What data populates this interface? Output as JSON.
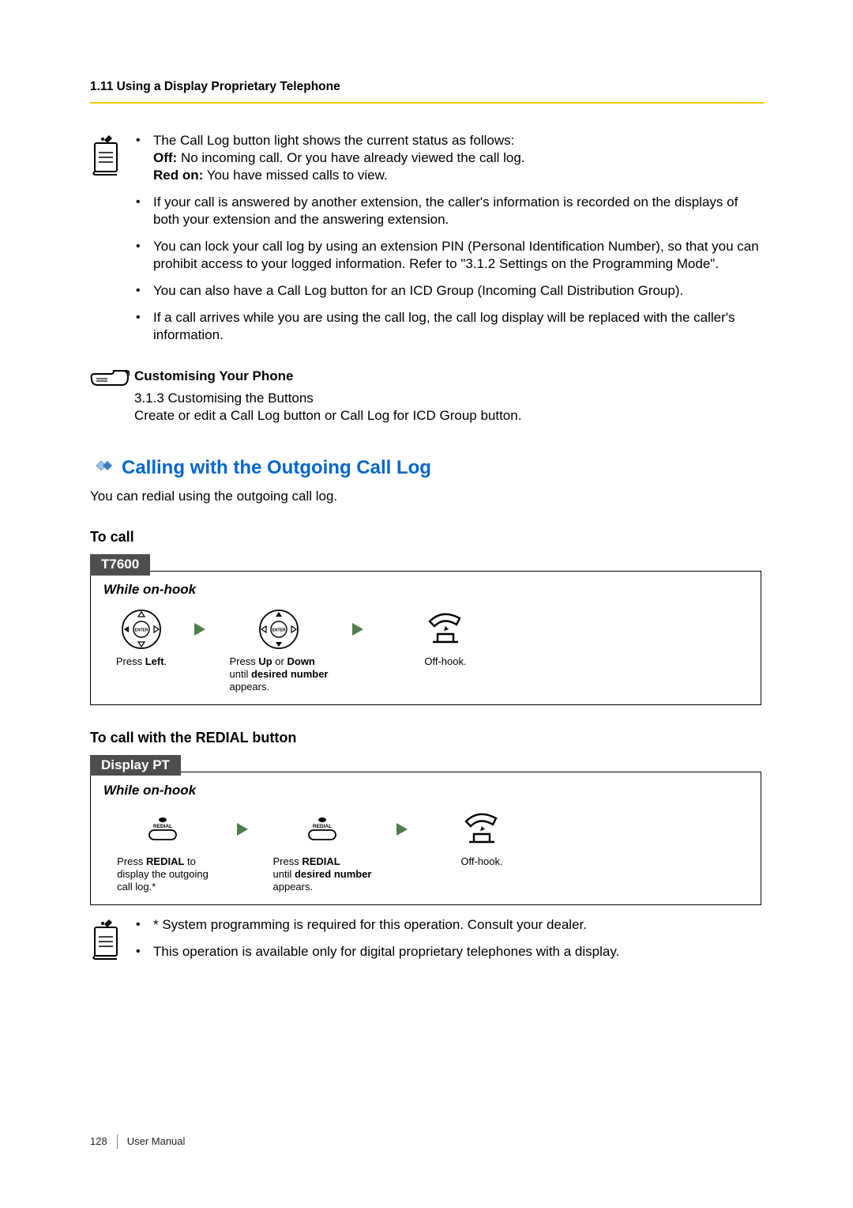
{
  "header": {
    "section": "1.11 Using a Display Proprietary Telephone"
  },
  "notes": {
    "b1_intro": "The Call Log button light shows the current status as follows:",
    "b1_off_label": "Off:",
    "b1_off_text": " No incoming call. Or you have already viewed the call log.",
    "b1_red_label": "Red on:",
    "b1_red_text": " You have missed calls to view.",
    "b2": "If your call is answered by another extension, the caller's information is recorded on the displays of both your extension and the answering extension.",
    "b3": "You can lock your call log by using an extension PIN (Personal Identification Number), so that you can prohibit access to your logged information. Refer to \"3.1.2 Settings on the Programming Mode\".",
    "b4": "You can also have a Call Log button for an ICD Group (Incoming Call Distribution Group).",
    "b5": "If a call arrives while you are using the call log, the call log display will be replaced with the caller's information."
  },
  "customising": {
    "title": "Customising Your Phone",
    "ref": "3.1.3 Customising the Buttons",
    "desc": "Create or edit a Call Log button or Call Log for ICD Group button."
  },
  "h2": "Calling with the Outgoing Call Log",
  "intro": "You can redial using the outgoing call log.",
  "proc1": {
    "h3": "To call",
    "tag": "T7600",
    "state": "While on-hook",
    "s1_pre": "Press ",
    "s1_bold": "Left",
    "s1_post": ".",
    "s2_pre": "Press ",
    "s2_bold1": "Up",
    "s2_mid": " or ",
    "s2_bold2": "Down",
    "s2_line2a": "until ",
    "s2_line2b": "desired number",
    "s2_line3": "appears.",
    "s3": "Off-hook."
  },
  "proc2": {
    "h3": "To call with the REDIAL button",
    "tag": "Display PT",
    "state": "While on-hook",
    "s1_pre": "Press ",
    "s1_bold": "REDIAL",
    "s1_post": " to",
    "s1_line2": "display the outgoing",
    "s1_line3": "call log.*",
    "s2_pre": "Press ",
    "s2_bold": "REDIAL",
    "s2_line2a": "until ",
    "s2_line2b": "desired number",
    "s2_line3": "appears.",
    "s3": "Off-hook."
  },
  "notes2": {
    "b1": "* System programming is required for this operation. Consult your dealer.",
    "b2": "This operation is available only for digital proprietary telephones with a display."
  },
  "redial_label": "REDIAL",
  "enter_label": "ENTER",
  "footer": {
    "page": "128",
    "doc": "User Manual"
  }
}
